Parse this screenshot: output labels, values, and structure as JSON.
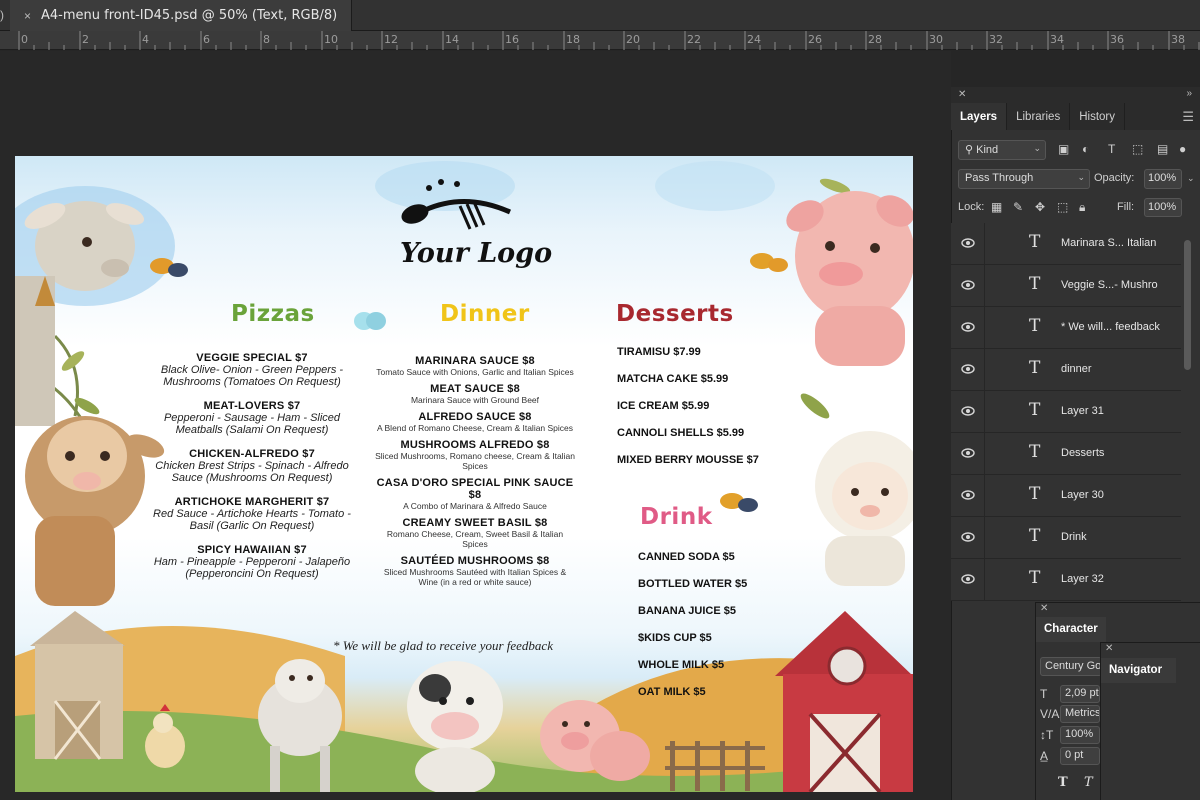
{
  "document_tab": {
    "prev_fragment": ")",
    "close": "×",
    "title": "A4-menu front-ID45.psd @ 50% (Text, RGB/8)"
  },
  "ruler": {
    "labels": [
      "0",
      "2",
      "4",
      "6",
      "8",
      "10",
      "12",
      "14",
      "16",
      "18",
      "20",
      "22",
      "24",
      "26",
      "28",
      "30",
      "32",
      "34",
      "36",
      "38"
    ]
  },
  "menu": {
    "logo_text": "Your Logo",
    "pizzas": {
      "heading": "Pizzas",
      "items": [
        {
          "title": "VEGGIE SPECIAL  $7",
          "desc": "Black Olive-  Onion - Green Peppers - Mushrooms (Tomatoes On Request)"
        },
        {
          "title": "MEAT-LOVERS $7",
          "desc": "Pepperoni - Sausage - Ham - Sliced Meatballs (Salami On Request)"
        },
        {
          "title": "CHICKEN-ALFREDO $7",
          "desc": "Chicken Brest Strips - Spinach - Alfredo Sauce (Mushrooms On Request)"
        },
        {
          "title": "ARTICHOKE MARGHERIT $7",
          "desc": "Red Sauce - Artichoke Hearts - Tomato - Basil (Garlic On Request)"
        },
        {
          "title": "SPICY HAWAIIAN $7",
          "desc": "Ham - Pineapple - Pepperoni - Jalapeño (Pepperoncini On Request)"
        }
      ]
    },
    "dinner": {
      "heading": "Dinner",
      "items": [
        {
          "title": "MARINARA SAUCE $8",
          "desc": "Tomato Sauce with Onions, Garlic and Italian Spices"
        },
        {
          "title": "MEAT SAUCE $8",
          "desc": "Marinara Sauce with Ground Beef"
        },
        {
          "title": "ALFREDO SAUCE $8",
          "desc": "A Blend of Romano Cheese, Cream & Italian Spices"
        },
        {
          "title": "MUSHROOMS ALFREDO $8",
          "desc": "Sliced Mushrooms, Romano cheese, Cream & Italian Spices"
        },
        {
          "title": "CASA D'ORO SPECIAL PINK SAUCE $8",
          "desc": "A Combo of Marinara & Alfredo Sauce"
        },
        {
          "title": "CREAMY SWEET BASIL $8",
          "desc": "Romano Cheese, Cream, Sweet Basil & Italian Spices"
        },
        {
          "title": "SAUTÉED MUSHROOMS $8",
          "desc": "Sliced Mushrooms Sautéed with Italian Spices & Wine (in a red or white sauce)"
        }
      ]
    },
    "desserts": {
      "heading": "Desserts",
      "items": [
        "TIRAMISU  $7.99",
        "MATCHA CAKE  $5.99",
        "ICE CREAM  $5.99",
        "CANNOLI SHELLS  $5.99",
        "MIXED BERRY MOUSSE $7"
      ]
    },
    "drink": {
      "heading": "Drink",
      "items": [
        "CANNED SODA $5",
        "BOTTLED WATER $5",
        "BANANA JUICE $5",
        "$KIDS CUP $5",
        "WHOLE MILK $5",
        "OAT MILK $5"
      ]
    },
    "feedback": "* We will be glad to receive your feedback",
    "colors": {
      "pizzas": "#6aa33a",
      "dinner": "#f0c419",
      "desserts": "#a8282f",
      "drink": "#e05b86"
    }
  },
  "panel": {
    "tabs": [
      "Layers",
      "Libraries",
      "History"
    ],
    "kind": "Kind",
    "blend_mode": "Pass Through",
    "opacity_label": "Opacity:",
    "opacity": "100%",
    "lock_label": "Lock:",
    "fill_label": "Fill:",
    "fill": "100%",
    "layers": [
      "Marinara S... Italian",
      "Veggie S...- Mushro",
      "* We will... feedback",
      "dinner",
      "Layer 31",
      "Desserts",
      "Layer 30",
      "Drink",
      "Layer 32"
    ]
  },
  "character": {
    "tab": "Character",
    "font": "Century Go",
    "size": "2,09 pt",
    "kerning": "Metrics",
    "scale": "100%",
    "baseline": "0 pt",
    "bold_glyph": "T",
    "italic_glyph": "T"
  },
  "navigator": {
    "tab": "Navigator"
  }
}
